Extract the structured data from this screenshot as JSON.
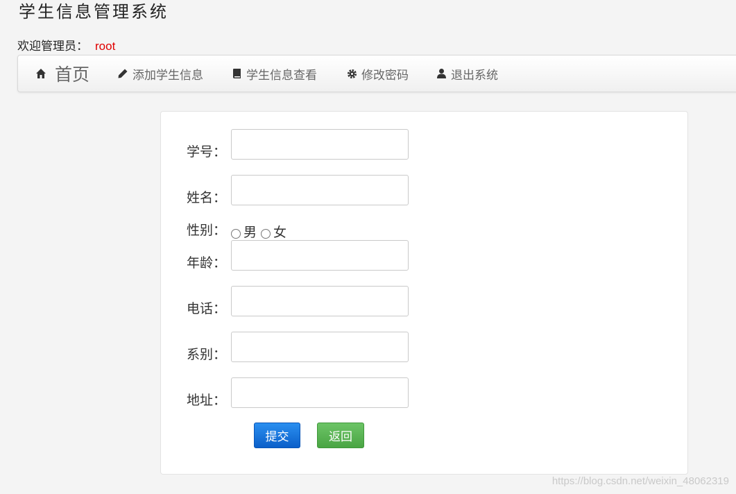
{
  "app_title": "学生信息管理系统",
  "welcome": {
    "label": "欢迎管理员：",
    "user": "root"
  },
  "nav": [
    {
      "label": "首页",
      "icon": "home-icon"
    },
    {
      "label": "添加学生信息",
      "icon": "pencil-icon"
    },
    {
      "label": "学生信息查看",
      "icon": "book-icon"
    },
    {
      "label": "修改密码",
      "icon": "gear-icon"
    },
    {
      "label": "退出系统",
      "icon": "user-icon"
    }
  ],
  "form": {
    "student_id_label": "学号：",
    "name_label": "姓名：",
    "gender_label": "性别：",
    "gender_options": [
      "男",
      "女"
    ],
    "age_label": "年龄：",
    "phone_label": "电话：",
    "department_label": "系别：",
    "address_label": "地址："
  },
  "buttons": {
    "submit": "提交",
    "back": "返回"
  },
  "watermark": "https://blog.csdn.net/weixin_48062319",
  "colors": {
    "username": "#e00000",
    "submit": "#0b5fc9",
    "back": "#4aa544"
  }
}
